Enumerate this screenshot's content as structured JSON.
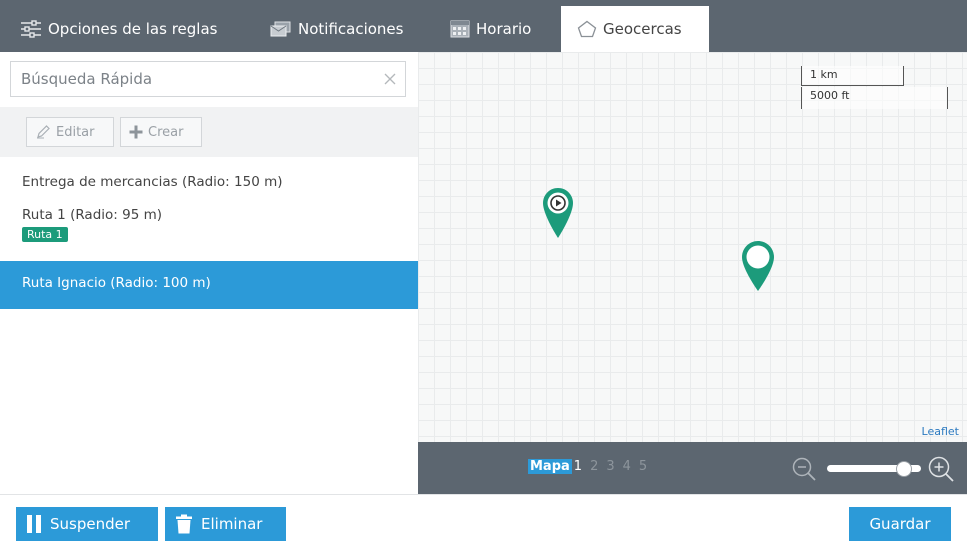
{
  "tabs": [
    {
      "label": "Opciones de las reglas",
      "icon": "sliders-icon"
    },
    {
      "label": "Notificaciones",
      "icon": "envelope-icon"
    },
    {
      "label": "Horario",
      "icon": "calendar-icon"
    },
    {
      "label": "Geocercas",
      "icon": "pentagon-icon",
      "active": true
    }
  ],
  "search": {
    "placeholder": "Búsqueda Rápida",
    "value": ""
  },
  "toolbar": {
    "edit_label": "Editar",
    "create_label": "Crear"
  },
  "geofences": [
    {
      "label": "Entrega de mercancias (Radio: 150 m)"
    },
    {
      "label": "Ruta 1 (Radio: 95 m)",
      "tag": "Ruta 1"
    },
    {
      "label": "Ruta Ignacio (Radio: 100 m)",
      "selected": true
    }
  ],
  "map": {
    "scale_km": "1 km",
    "scale_ft": "5000 ft",
    "attribution": "Leaflet",
    "pager_label": "Mapa",
    "pages": [
      "1",
      "2",
      "3",
      "4",
      "5"
    ],
    "current_page": "1",
    "zoom_level": 0.82
  },
  "footer": {
    "suspend_label": "Suspender",
    "delete_label": "Eliminar",
    "save_label": "Guardar"
  },
  "colors": {
    "accent": "#2c9ad8",
    "marker": "#1c9b7b",
    "header": "#5c6670",
    "tag": "#1c9b7b"
  }
}
